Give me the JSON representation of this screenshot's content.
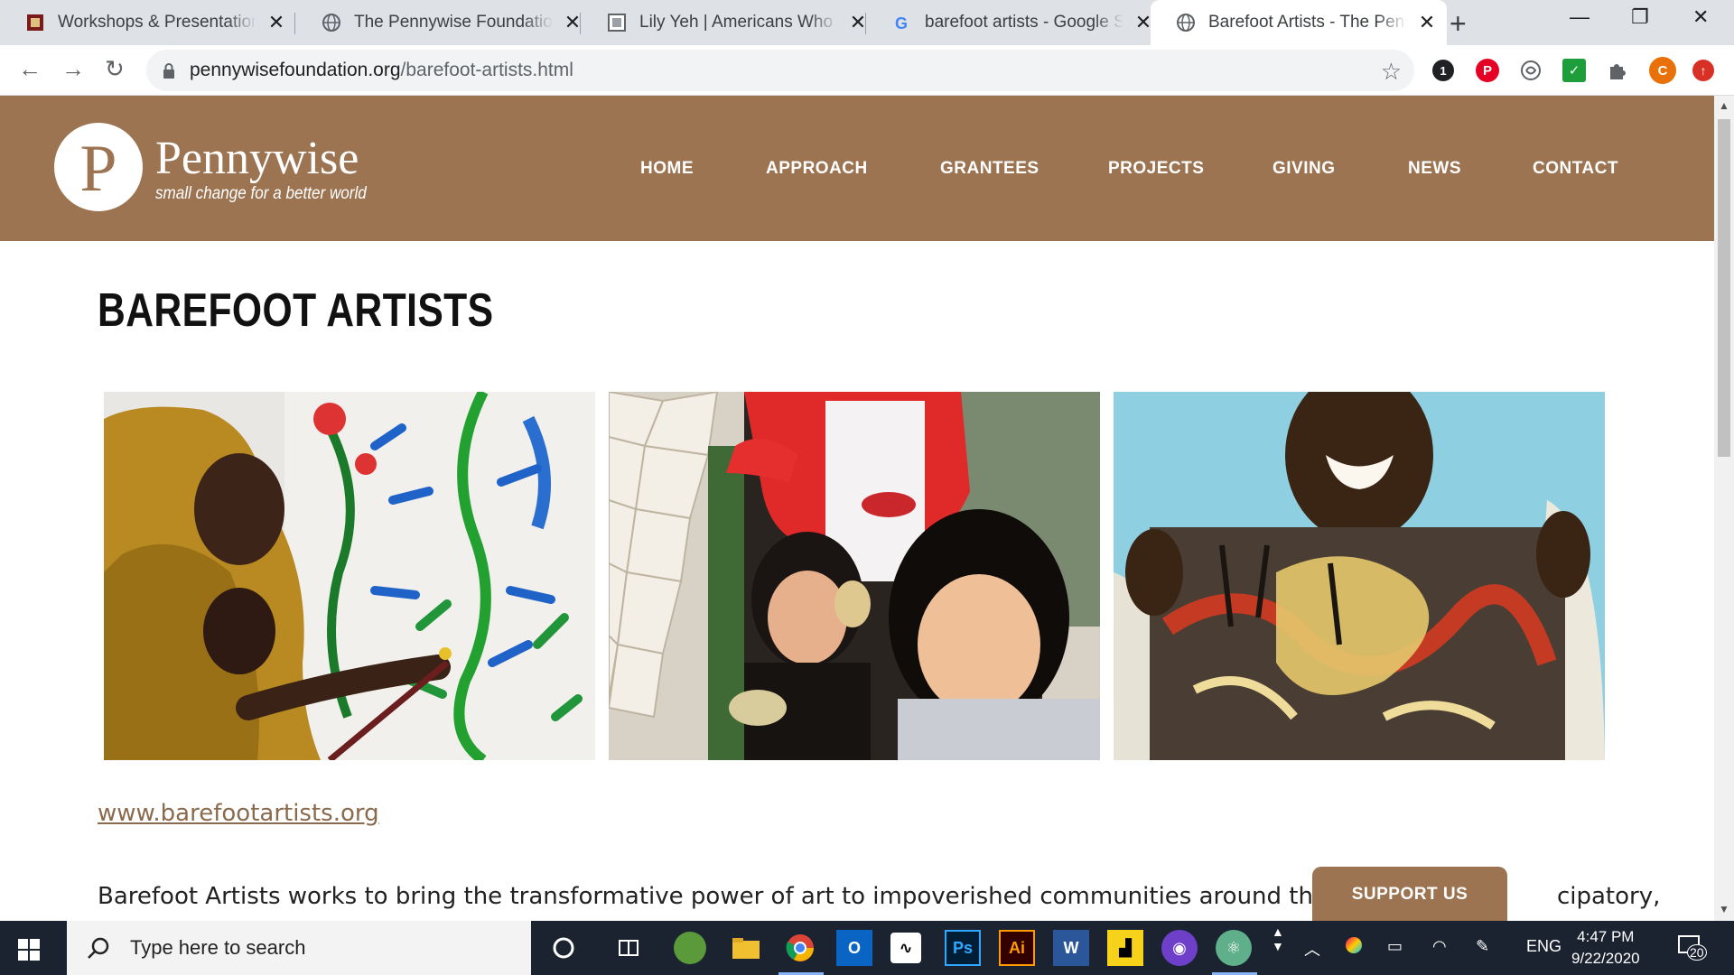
{
  "browser": {
    "tabs": [
      {
        "title": "Workshops & Presentations",
        "favicon": "gift-icon"
      },
      {
        "title": "The Pennywise Foundation",
        "favicon": "globe-icon"
      },
      {
        "title": "Lily Yeh | Americans Who Tell the Truth",
        "favicon": "square-icon"
      },
      {
        "title": "barefoot artists - Google Search",
        "favicon": "google-icon"
      },
      {
        "title": "Barefoot Artists - The Pennywise Foundation",
        "favicon": "globe-icon",
        "active": true
      }
    ],
    "url_domain": "pennywisefoundation.org",
    "url_path": "/barefoot-artists.html",
    "extensions": [
      {
        "name": "counter-extension",
        "label": "1"
      },
      {
        "name": "pinterest-extension",
        "label": "P"
      },
      {
        "name": "grammar-extension",
        "label": ""
      },
      {
        "name": "checkmark-extension",
        "label": "✓"
      },
      {
        "name": "puzzle-extension",
        "label": ""
      },
      {
        "name": "profile-avatar",
        "label": "C"
      },
      {
        "name": "update-extension",
        "label": ""
      }
    ]
  },
  "site": {
    "logo_letter": "P",
    "logo_name": "Pennywise",
    "logo_tagline": "small change for a better world",
    "nav": [
      "HOME",
      "APPROACH",
      "GRANTEES",
      "PROJECTS",
      "GIVING",
      "NEWS",
      "CONTACT"
    ],
    "brand_color": "#9c7451"
  },
  "content": {
    "title": "BAREFOOT ARTISTS",
    "link": "www.barefootartists.org",
    "body_visible_left": "Barefoot Artists works to bring the transformative power of art to impoverished communities around the gl",
    "body_visible_right": "cipatory,",
    "photos": [
      "child-painting-mural-photo",
      "girls-mosaic-wall-photo",
      "boy-holding-painting-photo"
    ]
  },
  "support_button": "SUPPORT US",
  "taskbar": {
    "search_placeholder": "Type here to search",
    "language": "ENG",
    "time": "4:47 PM",
    "date": "9/22/2020",
    "notifications": "20"
  }
}
